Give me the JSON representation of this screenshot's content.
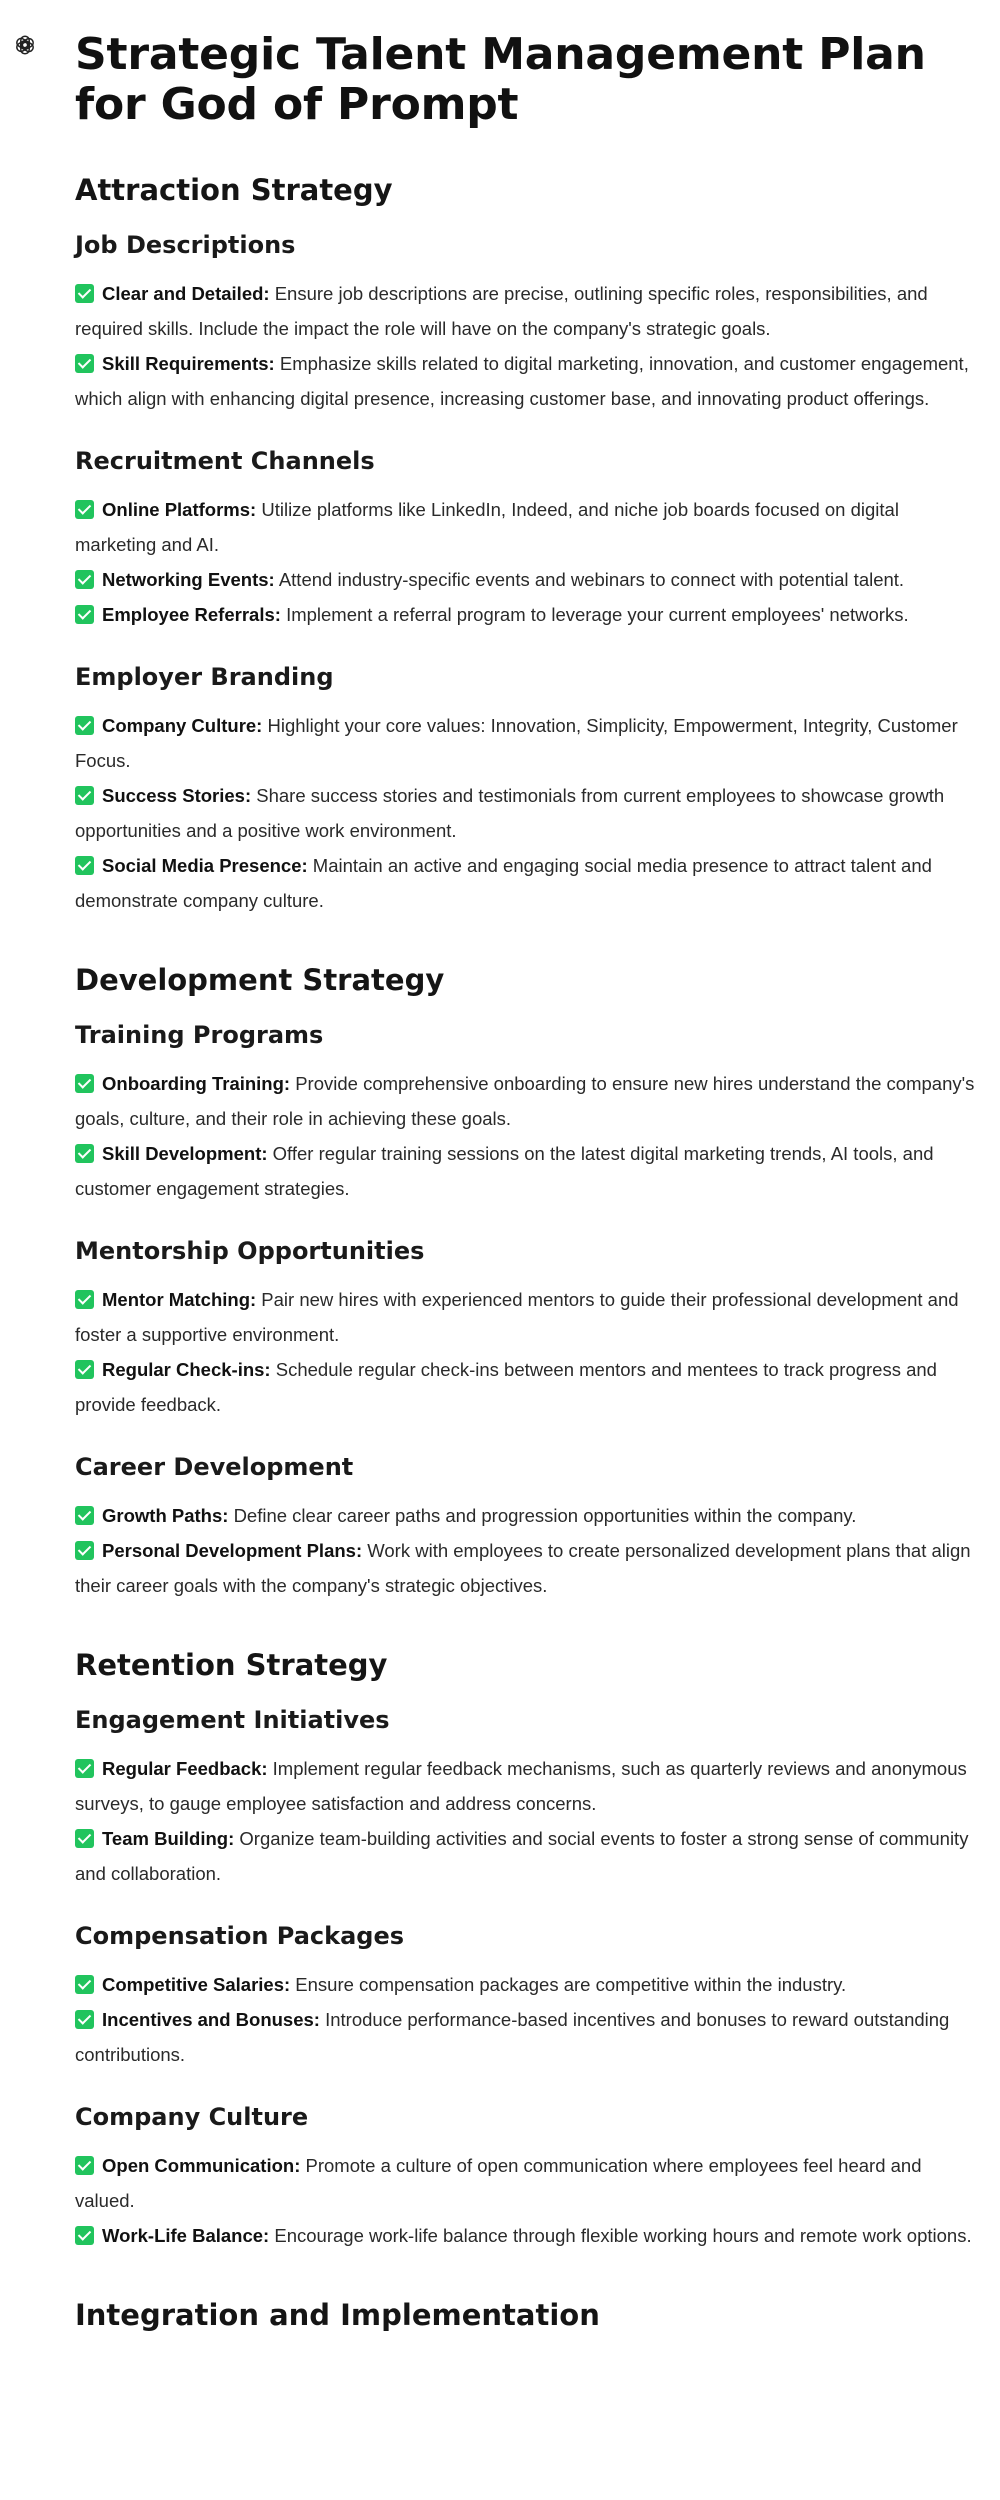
{
  "title": "Strategic Talent Management Plan for God of Prompt",
  "sections": [
    {
      "heading": "Attraction Strategy",
      "subsections": [
        {
          "heading": "Job Descriptions",
          "items": [
            {
              "term": "Clear and Detailed:",
              "text": "Ensure job descriptions are precise, outlining specific roles, responsibilities, and required skills. Include the impact the role will have on the company's strategic goals."
            },
            {
              "term": "Skill Requirements:",
              "text": "Emphasize skills related to digital marketing, innovation, and customer engagement, which align with enhancing digital presence, increasing customer base, and innovating product offerings."
            }
          ]
        },
        {
          "heading": "Recruitment Channels",
          "items": [
            {
              "term": "Online Platforms:",
              "text": "Utilize platforms like LinkedIn, Indeed, and niche job boards focused on digital marketing and AI."
            },
            {
              "term": "Networking Events:",
              "text": "Attend industry-specific events and webinars to connect with potential talent."
            },
            {
              "term": "Employee Referrals:",
              "text": "Implement a referral program to leverage your current employees' networks."
            }
          ]
        },
        {
          "heading": "Employer Branding",
          "items": [
            {
              "term": "Company Culture:",
              "text": "Highlight your core values: Innovation, Simplicity, Empowerment, Integrity, Customer Focus."
            },
            {
              "term": "Success Stories:",
              "text": "Share success stories and testimonials from current employees to showcase growth opportunities and a positive work environment."
            },
            {
              "term": "Social Media Presence:",
              "text": "Maintain an active and engaging social media presence to attract talent and demonstrate company culture."
            }
          ]
        }
      ]
    },
    {
      "heading": "Development Strategy",
      "subsections": [
        {
          "heading": "Training Programs",
          "items": [
            {
              "term": "Onboarding Training:",
              "text": "Provide comprehensive onboarding to ensure new hires understand the company's goals, culture, and their role in achieving these goals."
            },
            {
              "term": "Skill Development:",
              "text": "Offer regular training sessions on the latest digital marketing trends, AI tools, and customer engagement strategies."
            }
          ]
        },
        {
          "heading": "Mentorship Opportunities",
          "items": [
            {
              "term": "Mentor Matching:",
              "text": "Pair new hires with experienced mentors to guide their professional development and foster a supportive environment."
            },
            {
              "term": "Regular Check-ins:",
              "text": "Schedule regular check-ins between mentors and mentees to track progress and provide feedback."
            }
          ]
        },
        {
          "heading": "Career Development",
          "items": [
            {
              "term": "Growth Paths:",
              "text": "Define clear career paths and progression opportunities within the company."
            },
            {
              "term": "Personal Development Plans:",
              "text": "Work with employees to create personalized development plans that align their career goals with the company's strategic objectives."
            }
          ]
        }
      ]
    },
    {
      "heading": "Retention Strategy",
      "subsections": [
        {
          "heading": "Engagement Initiatives",
          "items": [
            {
              "term": "Regular Feedback:",
              "text": "Implement regular feedback mechanisms, such as quarterly reviews and anonymous surveys, to gauge employee satisfaction and address concerns."
            },
            {
              "term": "Team Building:",
              "text": "Organize team-building activities and social events to foster a strong sense of community and collaboration."
            }
          ]
        },
        {
          "heading": "Compensation Packages",
          "items": [
            {
              "term": "Competitive Salaries:",
              "text": "Ensure compensation packages are competitive within the industry."
            },
            {
              "term": "Incentives and Bonuses:",
              "text": "Introduce performance-based incentives and bonuses to reward outstanding contributions."
            }
          ]
        },
        {
          "heading": "Company Culture",
          "items": [
            {
              "term": "Open Communication:",
              "text": "Promote a culture of open communication where employees feel heard and valued."
            },
            {
              "term": "Work-Life Balance:",
              "text": "Encourage work-life balance through flexible working hours and remote work options."
            }
          ]
        }
      ]
    }
  ],
  "final_heading": "Integration and Implementation",
  "colors": {
    "check": "#21c45d",
    "text": "#2a2a2a",
    "heading": "#111111"
  },
  "icons": {
    "logo": "openai-logo-icon",
    "bullet": "check-mark-icon"
  }
}
